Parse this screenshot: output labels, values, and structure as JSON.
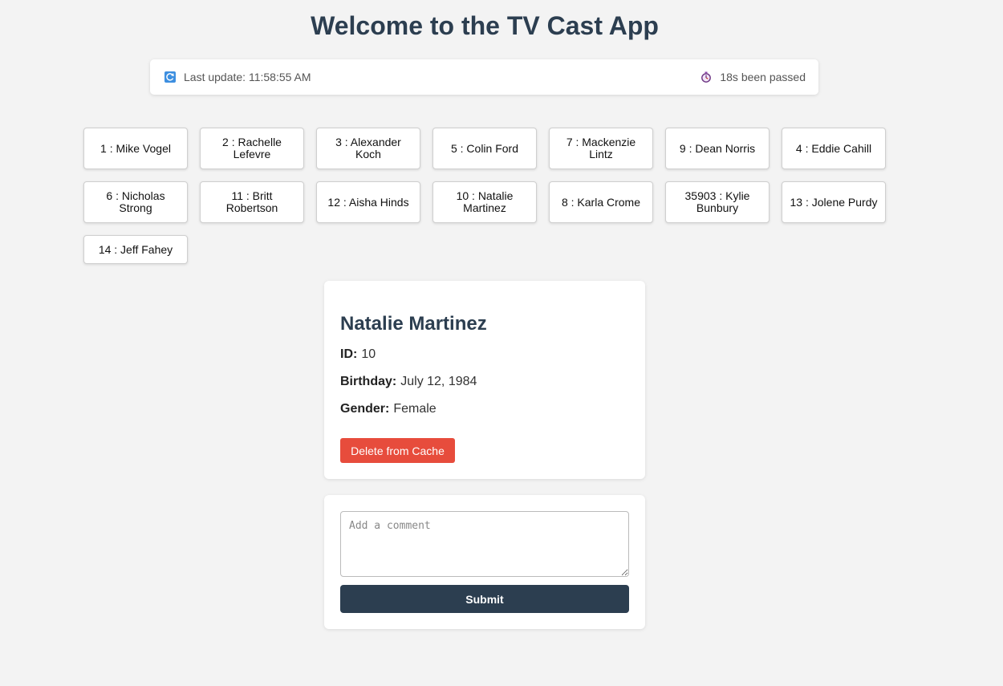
{
  "header": {
    "title": "Welcome to the TV Cast App"
  },
  "status": {
    "last_update_label": "Last update: 11:58:55 AM",
    "elapsed_label": "18s been passed",
    "icons": [
      "refresh-icon",
      "stopwatch-icon"
    ]
  },
  "cast": [
    {
      "label": "1 : Mike Vogel"
    },
    {
      "label": "2 : Rachelle Lefevre"
    },
    {
      "label": "3 : Alexander Koch"
    },
    {
      "label": "5 : Colin Ford"
    },
    {
      "label": "7 : Mackenzie Lintz"
    },
    {
      "label": "9 : Dean Norris"
    },
    {
      "label": "4 : Eddie Cahill"
    },
    {
      "label": "6 : Nicholas Strong"
    },
    {
      "label": "11 : Britt Robertson"
    },
    {
      "label": "12 : Aisha Hinds"
    },
    {
      "label": "10 : Natalie Martinez"
    },
    {
      "label": "8 : Karla Crome"
    },
    {
      "label": "35903 : Kylie Bunbury"
    },
    {
      "label": "13 : Jolene Purdy"
    },
    {
      "label": "14 : Jeff Fahey"
    }
  ],
  "detail": {
    "name": "Natalie Martinez",
    "id_label": "ID:",
    "id_value": "10",
    "birthday_label": "Birthday:",
    "birthday_value": "July 12, 1984",
    "gender_label": "Gender:",
    "gender_value": "Female",
    "delete_label": "Delete from Cache"
  },
  "comment": {
    "placeholder": "Add a comment",
    "submit_label": "Submit"
  },
  "colors": {
    "background": "#f3f3f3",
    "title": "#2c3e50",
    "delete": "#e74c3c",
    "submit": "#2c3e50"
  }
}
